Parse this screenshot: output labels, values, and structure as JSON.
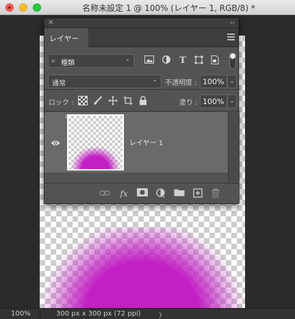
{
  "window": {
    "title": "名称未設定 1 @ 100% (レイヤー 1, RGB/8) *"
  },
  "panel": {
    "tab_label": "レイヤー",
    "filter": {
      "selected": "種類"
    },
    "blend_mode": "通常",
    "opacity_label": "不透明度 :",
    "opacity_value": "100%",
    "lock_label": "ロック :",
    "fill_label": "塗り :",
    "fill_value": "100%",
    "layers": [
      {
        "name": "レイヤー 1",
        "visible": true,
        "selected": true
      }
    ],
    "bottom_fx": "fx"
  },
  "status": {
    "zoom": "100%",
    "doc_info": "300 px x 300 px (72 ppi)"
  },
  "colors": {
    "layer_content": "#c21fc4",
    "panel_bg": "#535353"
  }
}
